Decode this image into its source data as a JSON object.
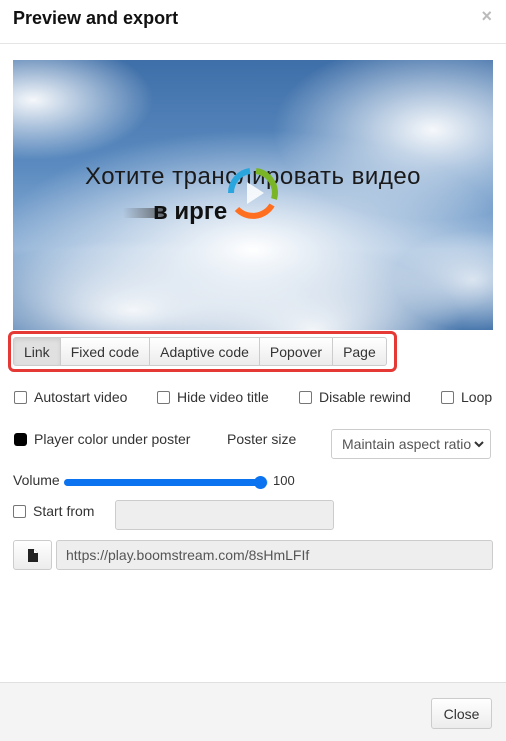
{
  "header": {
    "title": "Preview and export",
    "close_icon": "×"
  },
  "poster": {
    "line1": "Хотите транслировать видео",
    "line2": "в ирге",
    "play_icon": "play-circle-logo",
    "logo_colors": [
      "#2aa6df",
      "#7ab527",
      "#ff6f1f"
    ]
  },
  "tabs": [
    {
      "label": "Link",
      "active": true
    },
    {
      "label": "Fixed code",
      "active": false
    },
    {
      "label": "Adaptive code",
      "active": false
    },
    {
      "label": "Popover",
      "active": false
    },
    {
      "label": "Page",
      "active": false
    }
  ],
  "highlight_color": "#e53935",
  "options": {
    "autostart": {
      "label": "Autostart video",
      "checked": false
    },
    "hide_title": {
      "label": "Hide video title",
      "checked": false
    },
    "disable_rewind": {
      "label": "Disable rewind",
      "checked": false
    },
    "loop": {
      "label": "Loop",
      "checked": false
    }
  },
  "player_color": {
    "label": "Player color under poster",
    "value": "#000000"
  },
  "poster_size": {
    "label": "Poster size",
    "selected": "Maintain aspect ratio"
  },
  "volume": {
    "label": "Volume",
    "value": 100,
    "max": 100,
    "value_text": "100",
    "accent": "#0b73f0"
  },
  "start_from": {
    "label": "Start from",
    "checked": false,
    "value": ""
  },
  "link": {
    "file_icon": "file-icon",
    "url": "https://play.boomstream.com/8sHmLFIf"
  },
  "footer": {
    "close_label": "Close"
  }
}
